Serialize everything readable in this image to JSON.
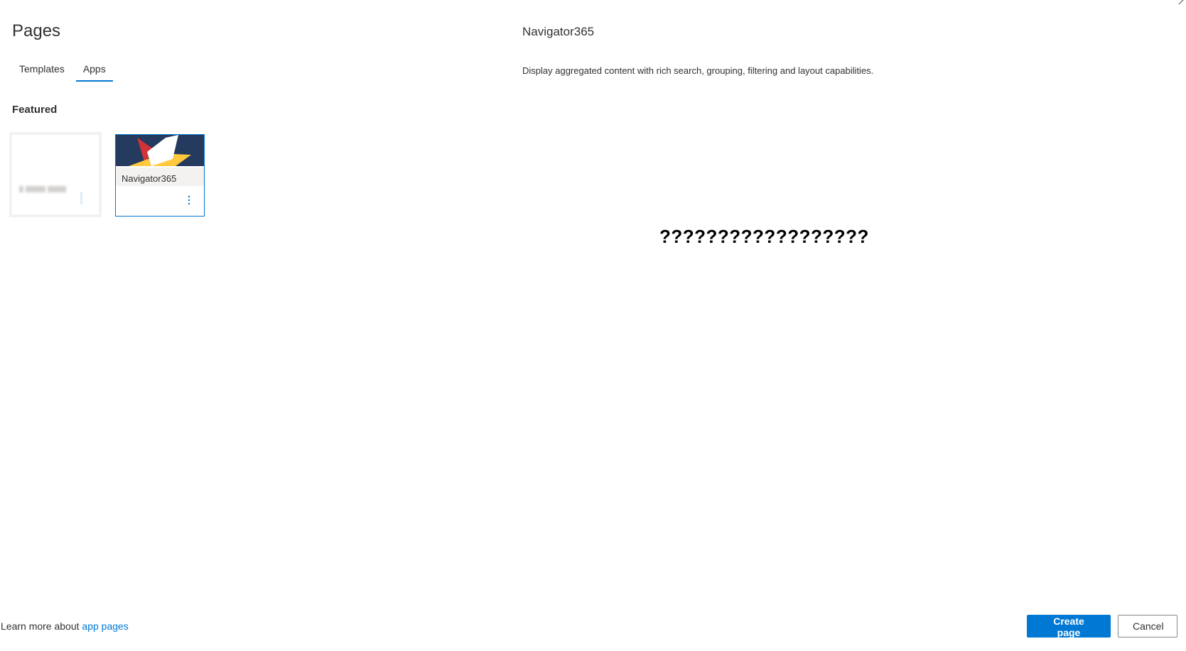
{
  "panel": {
    "title": "Pages"
  },
  "tabs": [
    {
      "label": "Templates",
      "active": false
    },
    {
      "label": "Apps",
      "active": true
    }
  ],
  "section": {
    "featured_label": "Featured"
  },
  "cards": [
    {
      "name": "",
      "blurred": true,
      "selected": false
    },
    {
      "name": "Navigator365",
      "blurred": false,
      "selected": true
    }
  ],
  "detail": {
    "title": "Navigator365",
    "description": "Display aggregated content with rich search, grouping, filtering and layout capabilities.",
    "preview_text": "??????????????????"
  },
  "footer": {
    "learn_prefix": "Learn more about ",
    "learn_link": "app pages",
    "create_label": "Create page",
    "cancel_label": "Cancel"
  },
  "colors": {
    "accent": "#0078d4",
    "thumb_bg": "#243a5e",
    "star_yellow": "#ffc83d",
    "star_red": "#d13438"
  }
}
